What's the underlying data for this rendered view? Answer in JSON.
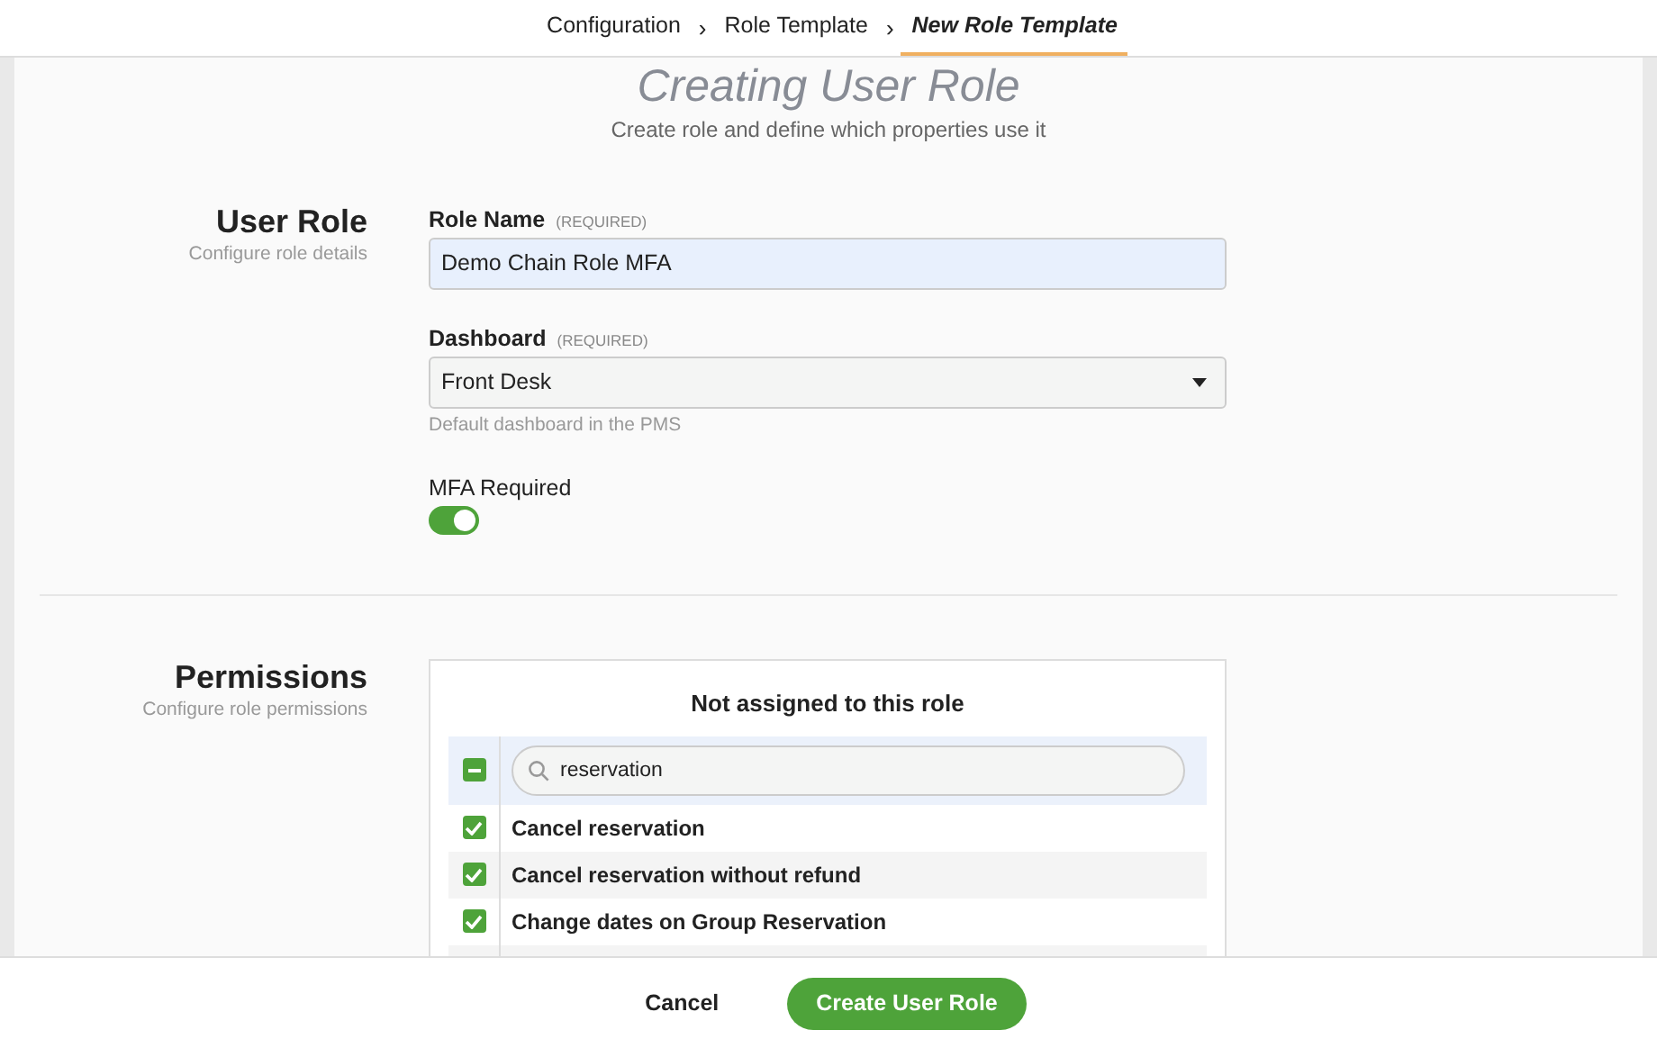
{
  "breadcrumbs": [
    {
      "label": "Configuration",
      "selected": false
    },
    {
      "label": "Role Template",
      "selected": false
    },
    {
      "label": "New Role Template",
      "selected": true
    }
  ],
  "breadcrumb_separator": "›",
  "page": {
    "title": "Creating User Role",
    "subtitle": "Create role and define which properties use it"
  },
  "user_role": {
    "title": "User Role",
    "subtitle": "Configure role details",
    "role_name": {
      "label": "Role Name",
      "hint": "(REQUIRED)",
      "value": "Demo Chain Role MFA"
    },
    "dashboard": {
      "label": "Dashboard",
      "hint": "(REQUIRED)",
      "value": "Front Desk",
      "help": "Default dashboard in the PMS"
    },
    "mfa": {
      "label": "MFA Required",
      "on": true
    }
  },
  "permissions": {
    "title": "Permissions",
    "subtitle": "Configure role permissions",
    "list_title": "Not assigned to this role",
    "select_all": {
      "indeterminate": true
    },
    "search": {
      "value": "reservation"
    },
    "items": [
      {
        "label": "Cancel reservation",
        "checked": true
      },
      {
        "label": "Cancel reservation without refund",
        "checked": true
      },
      {
        "label": "Change dates on Group Reservation",
        "checked": true
      }
    ]
  },
  "footer": {
    "cancel": "Cancel",
    "submit": "Create User Role"
  }
}
